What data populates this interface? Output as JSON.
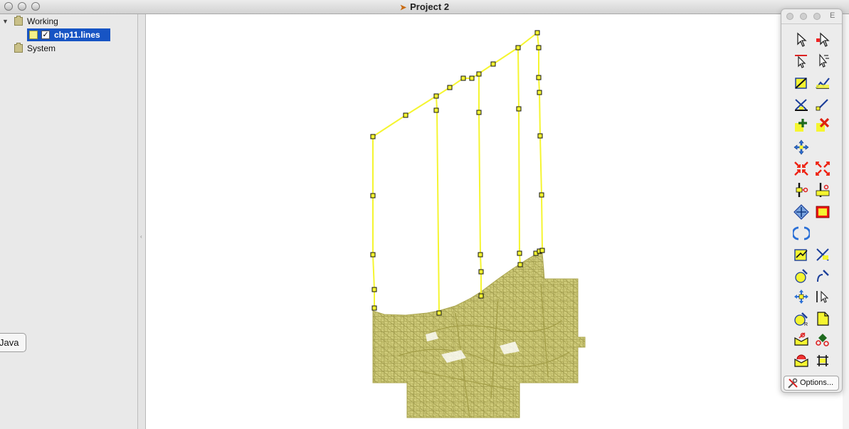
{
  "window": {
    "title": "Project 2"
  },
  "tree": {
    "items": [
      {
        "label": "Working",
        "expanded": true
      },
      {
        "label": "chp11.lines",
        "selected": true,
        "checked": true,
        "swatch_color": "#f4f18a"
      },
      {
        "label": "System"
      }
    ],
    "java_button_label": "Java"
  },
  "palette": {
    "title": "E",
    "options_label": "Options..."
  },
  "colors": {
    "selection": "#1754c4",
    "edit_line": "#f5f530",
    "parcel_fill": "#cfcb7a",
    "parcel_stroke": "#b0ab55"
  }
}
